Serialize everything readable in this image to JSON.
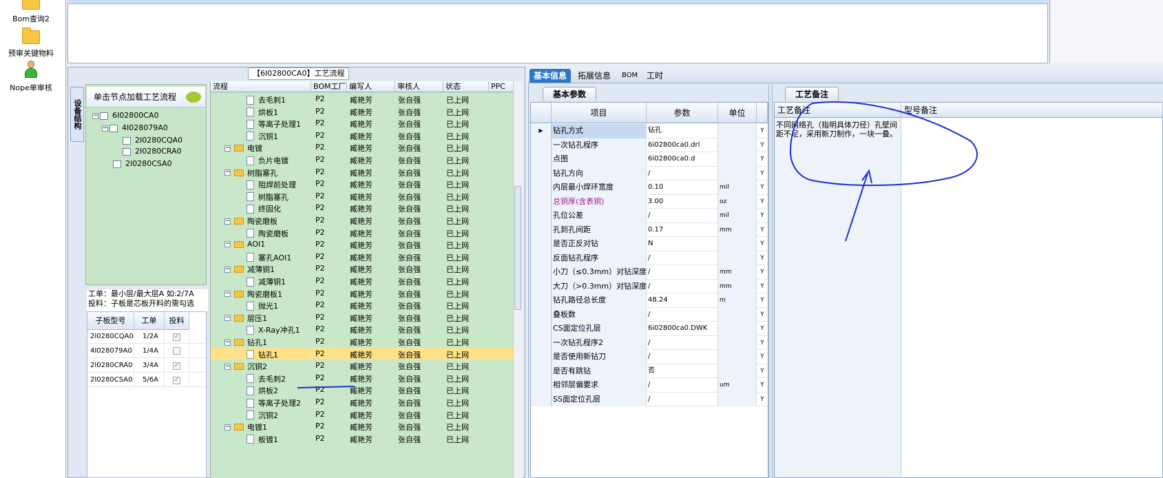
{
  "launcher": {
    "items": [
      {
        "label": "Bom查询2",
        "icon": "folder-icon"
      },
      {
        "label": "预审关键物料",
        "icon": "folder-icon"
      },
      {
        "label": "Nope单审核",
        "icon": "person-icon"
      }
    ]
  },
  "process_panel": {
    "title": "【6I02800CA0】工艺流程",
    "side_tab": "设备结构",
    "tree_header": "单击节点加载工艺流程",
    "tree": [
      {
        "label": "6I02800CA0",
        "expander": "−"
      },
      {
        "label": "4I028079A0",
        "expander": "−"
      },
      {
        "label": "2I0280CQA0",
        "expander": ""
      },
      {
        "label": "2I0280CRA0",
        "expander": ""
      },
      {
        "label": "2I0280CSA0",
        "expander": ""
      }
    ],
    "work_note_1": "工单：最小层/最大层A 如:2/7A",
    "work_note_2": "投料：子板是芯板开料的需勾选",
    "sub_table": {
      "headers": [
        "子板型号",
        "工单",
        "投料"
      ],
      "rows": [
        {
          "model": "2I0280CQA0",
          "order": "1/2A",
          "check": "✓"
        },
        {
          "model": "4I028079A0",
          "order": "1/4A",
          "check": ""
        },
        {
          "model": "2I0280CRA0",
          "order": "3/4A",
          "check": "✓"
        },
        {
          "model": "2I0280CSA0",
          "order": "5/6A",
          "check": "✓"
        }
      ]
    },
    "grid": {
      "headers": [
        "流程",
        "BOM工厂",
        "编写人",
        "审核人",
        "状态",
        "PPC"
      ],
      "rows": [
        {
          "type": "doc",
          "name": "去毛刺1",
          "bom": "P2",
          "writer": "臧艳芳",
          "reviewer": "张自强",
          "status": "已上网"
        },
        {
          "type": "doc",
          "name": "烘板1",
          "bom": "P2",
          "writer": "臧艳芳",
          "reviewer": "张自强",
          "status": "已上网"
        },
        {
          "type": "doc",
          "name": "等离子处理1",
          "bom": "P2",
          "writer": "臧艳芳",
          "reviewer": "张自强",
          "status": "已上网"
        },
        {
          "type": "doc",
          "name": "沉铜1",
          "bom": "P2",
          "writer": "臧艳芳",
          "reviewer": "张自强",
          "status": "已上网"
        },
        {
          "type": "folder",
          "name": "电镀",
          "bom": "P2",
          "writer": "臧艳芳",
          "reviewer": "张自强",
          "status": "已上网"
        },
        {
          "type": "doc",
          "name": "负片电镀",
          "bom": "P2",
          "writer": "臧艳芳",
          "reviewer": "张自强",
          "status": "已上网"
        },
        {
          "type": "folder",
          "name": "树脂塞孔",
          "bom": "P2",
          "writer": "臧艳芳",
          "reviewer": "张自强",
          "status": "已上网"
        },
        {
          "type": "doc",
          "name": "阻焊前处理",
          "bom": "P2",
          "writer": "臧艳芳",
          "reviewer": "张自强",
          "status": "已上网"
        },
        {
          "type": "doc",
          "name": "树脂塞孔",
          "bom": "P2",
          "writer": "臧艳芳",
          "reviewer": "张自强",
          "status": "已上网"
        },
        {
          "type": "doc",
          "name": "终固化",
          "bom": "P2",
          "writer": "臧艳芳",
          "reviewer": "张自强",
          "status": "已上网"
        },
        {
          "type": "folder",
          "name": "陶瓷磨板",
          "bom": "P2",
          "writer": "臧艳芳",
          "reviewer": "张自强",
          "status": "已上网"
        },
        {
          "type": "doc",
          "name": "陶瓷磨板",
          "bom": "P2",
          "writer": "臧艳芳",
          "reviewer": "张自强",
          "status": "已上网"
        },
        {
          "type": "folder",
          "name": "AOI1",
          "bom": "P2",
          "writer": "臧艳芳",
          "reviewer": "张自强",
          "status": "已上网"
        },
        {
          "type": "doc",
          "name": "塞孔AOI1",
          "bom": "P2",
          "writer": "臧艳芳",
          "reviewer": "张自强",
          "status": "已上网"
        },
        {
          "type": "folder",
          "name": "减薄铜1",
          "bom": "P2",
          "writer": "臧艳芳",
          "reviewer": "张自强",
          "status": "已上网"
        },
        {
          "type": "doc",
          "name": "减薄铜1",
          "bom": "P2",
          "writer": "臧艳芳",
          "reviewer": "张自强",
          "status": "已上网"
        },
        {
          "type": "folder",
          "name": "陶瓷磨板1",
          "bom": "P2",
          "writer": "臧艳芳",
          "reviewer": "张自强",
          "status": "已上网"
        },
        {
          "type": "doc",
          "name": "抛光1",
          "bom": "P2",
          "writer": "臧艳芳",
          "reviewer": "张自强",
          "status": "已上网"
        },
        {
          "type": "folder",
          "name": "层压1",
          "bom": "P2",
          "writer": "臧艳芳",
          "reviewer": "张自强",
          "status": "已上网"
        },
        {
          "type": "doc",
          "name": "X-Ray冲孔1",
          "bom": "P2",
          "writer": "臧艳芳",
          "reviewer": "张自强",
          "status": "已上网"
        },
        {
          "type": "folder",
          "name": "钻孔1",
          "bom": "P2",
          "writer": "臧艳芳",
          "reviewer": "张自强",
          "status": "已上网"
        },
        {
          "type": "doc",
          "name": "钻孔1",
          "bom": "P2",
          "writer": "臧艳芳",
          "reviewer": "张自强",
          "status": "已上网",
          "selected": true
        },
        {
          "type": "folder",
          "name": "沉铜2",
          "bom": "P2",
          "writer": "臧艳芳",
          "reviewer": "张自强",
          "status": "已上网"
        },
        {
          "type": "doc",
          "name": "去毛刺2",
          "bom": "P2",
          "writer": "臧艳芳",
          "reviewer": "张自强",
          "status": "已上网"
        },
        {
          "type": "doc",
          "name": "烘板2",
          "bom": "P2",
          "writer": "臧艳芳",
          "reviewer": "张自强",
          "status": "已上网"
        },
        {
          "type": "doc",
          "name": "等离子处理2",
          "bom": "P2",
          "writer": "臧艳芳",
          "reviewer": "张自强",
          "status": "已上网"
        },
        {
          "type": "doc",
          "name": "沉铜2",
          "bom": "P2",
          "writer": "臧艳芳",
          "reviewer": "张自强",
          "status": "已上网"
        },
        {
          "type": "folder",
          "name": "电镀1",
          "bom": "P2",
          "writer": "臧艳芳",
          "reviewer": "张自强",
          "status": "已上网"
        },
        {
          "type": "doc",
          "name": "板镀1",
          "bom": "P2",
          "writer": "臧艳芳",
          "reviewer": "张自强",
          "status": "已上网"
        }
      ]
    }
  },
  "detail_panel": {
    "tabs": [
      "基本信息",
      "拓展信息",
      "BOM",
      "工时"
    ],
    "active_tab": "基本信息",
    "basic_params_tab": "基本参数",
    "params_headers": [
      "项目",
      "参数",
      "单位"
    ],
    "params": [
      {
        "item": "钻孔方式",
        "value": "钻孔",
        "unit": "",
        "flag": "Y",
        "current": true
      },
      {
        "item": "一次钻孔程序",
        "value": "6i02800ca0.drl",
        "unit": "",
        "flag": "Y"
      },
      {
        "item": "点图",
        "value": "6i02800ca0.d",
        "unit": "",
        "flag": "Y"
      },
      {
        "item": "钻孔方向",
        "value": "/",
        "unit": "",
        "flag": "Y"
      },
      {
        "item": "内层最小焊环宽度",
        "value": "0.10",
        "unit": "mil",
        "flag": "Y"
      },
      {
        "item": "总铜厚(含表铜)",
        "value": "3.00",
        "unit": "oz",
        "flag": "Y",
        "highlight": true
      },
      {
        "item": "孔位公差",
        "value": "/",
        "unit": "mil",
        "flag": "Y"
      },
      {
        "item": "孔到孔间距",
        "value": "0.17",
        "unit": "mm",
        "flag": "Y"
      },
      {
        "item": "是否正反对钻",
        "value": "N",
        "unit": "",
        "flag": "Y"
      },
      {
        "item": "反面钻孔程序",
        "value": "/",
        "unit": "",
        "flag": "Y"
      },
      {
        "item": "小刀（≤0.3mm）对钻深度",
        "value": "/",
        "unit": "mm",
        "flag": "Y"
      },
      {
        "item": "大刀（>0.3mm）对钻深度",
        "value": "/",
        "unit": "mm",
        "flag": "Y"
      },
      {
        "item": "钻孔路径总长度",
        "value": "48.24",
        "unit": "m",
        "flag": "Y"
      },
      {
        "item": "叠板数",
        "value": "/",
        "unit": "",
        "flag": "Y"
      },
      {
        "item": "CS面定位孔层",
        "value": "6i02800ca0.DWK",
        "unit": "",
        "flag": "Y"
      },
      {
        "item": "一次钻孔程序2",
        "value": "/",
        "unit": "",
        "flag": "Y"
      },
      {
        "item": "是否使用新钻刀",
        "value": "/",
        "unit": "",
        "flag": "Y"
      },
      {
        "item": "是否有跳钻",
        "value": "否",
        "unit": "",
        "flag": "Y"
      },
      {
        "item": "相邻层偏要求",
        "value": "/",
        "unit": "um",
        "flag": "Y"
      },
      {
        "item": "SS面定位孔层",
        "value": "/",
        "unit": "",
        "flag": "Y"
      }
    ],
    "process_note_tab": "工艺备注",
    "note_headers": [
      "工艺备注",
      "型号备注"
    ],
    "process_note": "不同网络孔（指明具体刀径）孔壁间距不足，采用新刀制作，一块一叠。"
  },
  "colors": {
    "grid_bg": "#c9e8c9",
    "selected_row": "#fde28a",
    "tab_active": "#2e76c8",
    "annotation_ink": "#1a2fd6",
    "highlight_text": "#a0238c"
  }
}
